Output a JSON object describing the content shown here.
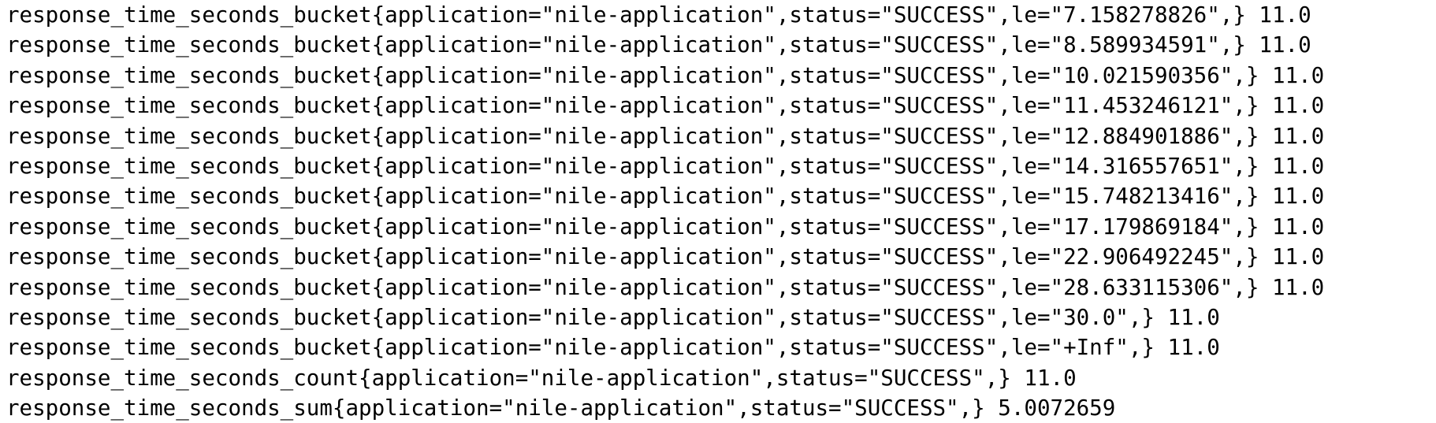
{
  "lines": [
    "response_time_seconds_bucket{application=\"nile-application\",status=\"SUCCESS\",le=\"7.158278826\",} 11.0",
    "response_time_seconds_bucket{application=\"nile-application\",status=\"SUCCESS\",le=\"8.589934591\",} 11.0",
    "response_time_seconds_bucket{application=\"nile-application\",status=\"SUCCESS\",le=\"10.021590356\",} 11.0",
    "response_time_seconds_bucket{application=\"nile-application\",status=\"SUCCESS\",le=\"11.453246121\",} 11.0",
    "response_time_seconds_bucket{application=\"nile-application\",status=\"SUCCESS\",le=\"12.884901886\",} 11.0",
    "response_time_seconds_bucket{application=\"nile-application\",status=\"SUCCESS\",le=\"14.316557651\",} 11.0",
    "response_time_seconds_bucket{application=\"nile-application\",status=\"SUCCESS\",le=\"15.748213416\",} 11.0",
    "response_time_seconds_bucket{application=\"nile-application\",status=\"SUCCESS\",le=\"17.179869184\",} 11.0",
    "response_time_seconds_bucket{application=\"nile-application\",status=\"SUCCESS\",le=\"22.906492245\",} 11.0",
    "response_time_seconds_bucket{application=\"nile-application\",status=\"SUCCESS\",le=\"28.633115306\",} 11.0",
    "response_time_seconds_bucket{application=\"nile-application\",status=\"SUCCESS\",le=\"30.0\",} 11.0",
    "response_time_seconds_bucket{application=\"nile-application\",status=\"SUCCESS\",le=\"+Inf\",} 11.0",
    "response_time_seconds_count{application=\"nile-application\",status=\"SUCCESS\",} 11.0",
    "response_time_seconds_sum{application=\"nile-application\",status=\"SUCCESS\",} 5.0072659"
  ]
}
